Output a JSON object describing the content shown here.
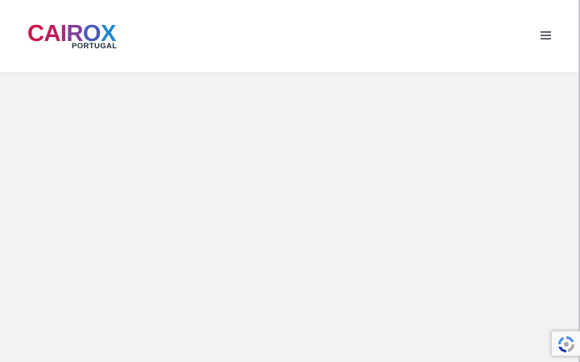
{
  "header": {
    "logo": {
      "letters": [
        {
          "char": "C",
          "color": "#c8174a"
        },
        {
          "char": "A",
          "color": "#c01a58"
        },
        {
          "char": "I",
          "color": "#a92a7a"
        },
        {
          "char": "R",
          "color": "#7f3f9a"
        },
        {
          "char": "O",
          "color": "#4a5cb8"
        },
        {
          "char": "X",
          "color": "#1f88d2"
        }
      ],
      "subtitle": "PORTUGAL",
      "subtitle_color": "#1b2b3a"
    },
    "menu_icon": "hamburger-menu-icon"
  },
  "colors": {
    "page_background": "#f1f2f4",
    "header_background": "#ffffff",
    "menu_icon": "#3a3d42"
  },
  "widgets": {
    "recaptcha_icon": "recaptcha-icon"
  }
}
